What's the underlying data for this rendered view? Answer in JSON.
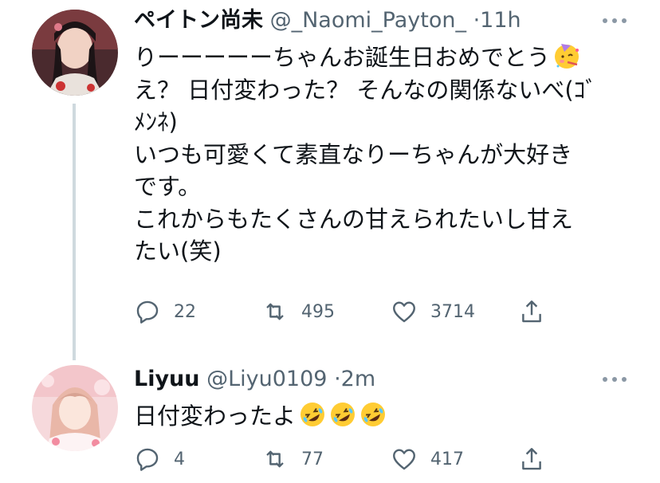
{
  "tweets": [
    {
      "name": "ペイトン尚未",
      "handle": "@_Naomi_Payton_",
      "separator": "·",
      "time": "11h",
      "lines": [
        "りーーーーーちゃんお誕生日おめでとう",
        "え？ 日付変わった？ そんなの関係ないべ(ｺﾞ",
        "ﾒﾝﾈ)",
        "いつも可愛くて素直なりーちゃんが大好き",
        "です。",
        "これからもたくさんの甘えられたいし甘え",
        "たい(笑)"
      ],
      "emoji": "partying-face",
      "replies": "22",
      "retweets": "495",
      "likes": "3714"
    },
    {
      "name": "Liyuu",
      "handle": "@Liyu0109",
      "separator": "·",
      "time": "2m",
      "lines": [
        "日付変わったよ"
      ],
      "emoji": "rolling-on-floor-laughing x3",
      "replies": "4",
      "retweets": "77",
      "likes": "417"
    }
  ],
  "colors": {
    "text": "#0f1419",
    "secondary": "#536471",
    "thread_line": "#cfd9de",
    "emoji_yellow": "#ffcc33"
  }
}
